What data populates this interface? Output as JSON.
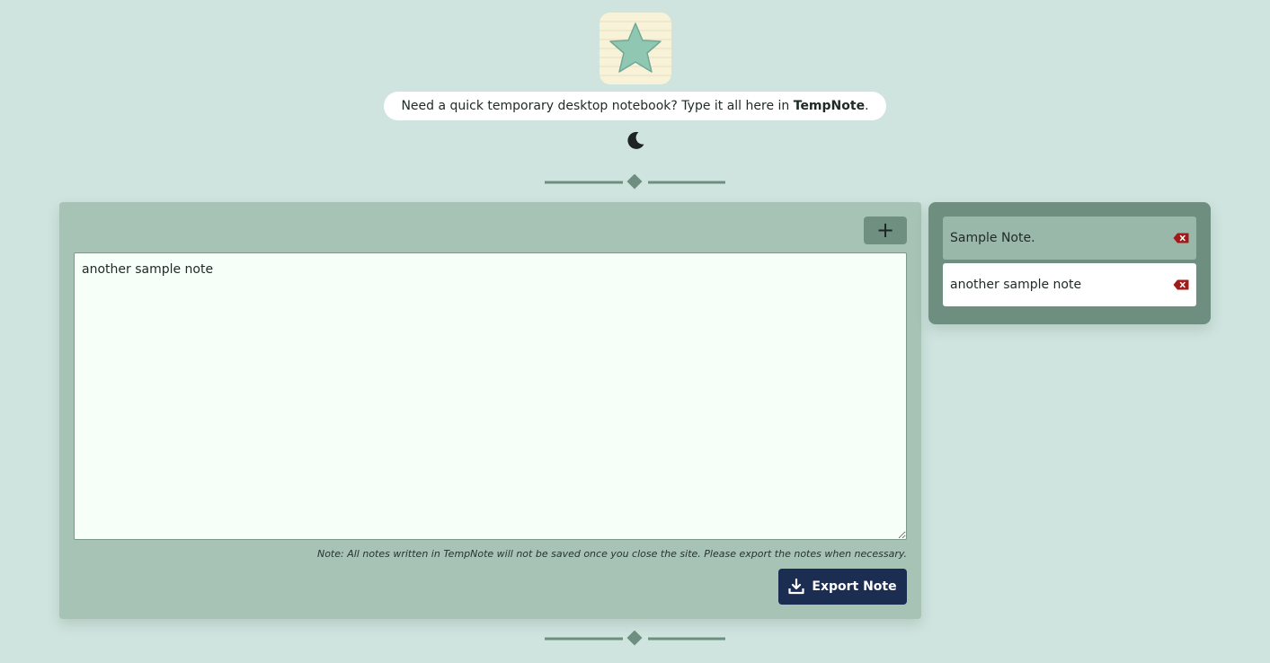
{
  "header": {
    "logo_icon": "star-notepad-logo",
    "tagline_text": "Need a quick temporary desktop notebook? Type it all here in ",
    "brand_name": "TempNote",
    "tagline_end": ".",
    "theme_toggle_icon": "moon-icon"
  },
  "editor": {
    "add_label": "+",
    "note_text": "another sample note",
    "notice": "Note: All notes written in TempNote will not be saved once you close the site. Please export the notes when necessary.",
    "export_label": "Export Note",
    "export_icon": "download-icon"
  },
  "notes_list": {
    "items": [
      {
        "title": "Sample Note.",
        "active": false
      },
      {
        "title": "another sample note",
        "active": true
      }
    ],
    "delete_icon": "backspace-delete-icon"
  },
  "colors": {
    "background": "#cfe4de",
    "panel": "#a6c3b6",
    "list_panel": "#6e8f80",
    "export_button": "#1c2d52",
    "delete_icon": "#a11a1a",
    "divider": "#6e8f80"
  }
}
